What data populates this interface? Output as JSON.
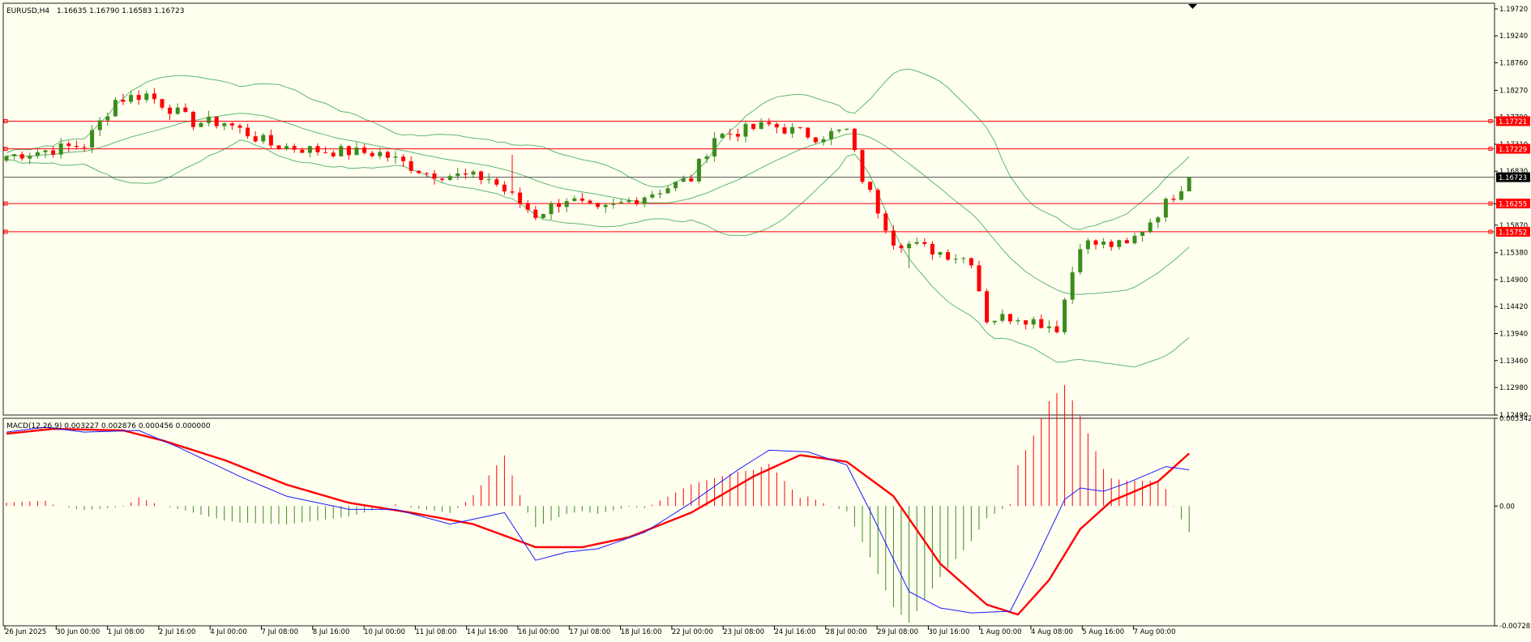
{
  "header": {
    "symbol": "EURUSD,H4",
    "ohlc": "1.16635 1.16790 1.16583 1.16723"
  },
  "colors": {
    "background": "#fffff0",
    "bull": "#3b8c1c",
    "bear": "#ff0000",
    "bands": "#5cb870",
    "hline": "#ff0000",
    "price_line": "#555555",
    "macd_line": "#1a1aff",
    "signal_line": "#ff0000"
  },
  "chart_data": [
    {
      "type": "candlestick",
      "title": "EURUSD,H4",
      "ohlc_readout": "1.16635 1.16790 1.16583 1.16723",
      "ylim": [
        1.1249,
        1.1982
      ],
      "y_ticks": [
        "1.19720",
        "1.19240",
        "1.18760",
        "1.18270",
        "1.17790",
        "1.17310",
        "1.16830",
        "1.16250",
        "1.15870",
        "1.15380",
        "1.14900",
        "1.14420",
        "1.13940",
        "1.13460",
        "1.12980",
        "1.12490"
      ],
      "x_labels": [
        "26 Jun 2025",
        "30 Jun 00:00",
        "1 Jul 08:00",
        "2 Jul 16:00",
        "4 Jul 00:00",
        "7 Jul 08:00",
        "8 Jul 16:00",
        "10 Jul 00:00",
        "11 Jul 08:00",
        "14 Jul 16:00",
        "16 Jul 00:00",
        "17 Jul 08:00",
        "18 Jul 16:00",
        "22 Jul 00:00",
        "23 Jul 08:00",
        "24 Jul 16:00",
        "28 Jul 00:00",
        "29 Jul 08:00",
        "30 Jul 16:00",
        "1 Aug 00:00",
        "4 Aug 08:00",
        "5 Aug 16:00",
        "7 Aug 00:00"
      ],
      "bar_count": 153,
      "anchors": [
        [
          0,
          1.171
        ],
        [
          10,
          1.173
        ],
        [
          14,
          1.181
        ],
        [
          18,
          1.182
        ],
        [
          24,
          1.177
        ],
        [
          28,
          1.177
        ],
        [
          34,
          1.173
        ],
        [
          40,
          1.172
        ],
        [
          48,
          1.1715
        ],
        [
          54,
          1.168
        ],
        [
          62,
          1.167
        ],
        [
          68,
          1.1605
        ],
        [
          72,
          1.1635
        ],
        [
          76,
          1.161
        ],
        [
          80,
          1.163
        ],
        [
          88,
          1.167
        ],
        [
          91,
          1.1745
        ],
        [
          98,
          1.1765
        ],
        [
          104,
          1.1745
        ],
        [
          108,
          1.1755
        ],
        [
          110,
          1.167
        ],
        [
          114,
          1.156
        ],
        [
          124,
          1.1525
        ],
        [
          126,
          1.142
        ],
        [
          130,
          1.1425
        ],
        [
          135,
          1.1405
        ],
        [
          138,
          1.1555
        ],
        [
          144,
          1.155
        ],
        [
          148,
          1.161
        ],
        [
          152,
          1.16723
        ]
      ],
      "horizontal_levels": [
        "1.17721",
        "1.17229",
        "1.16255",
        "1.15752"
      ],
      "current_price": "1.16723",
      "indicator": "Bollinger Bands"
    },
    {
      "type": "line",
      "title": "MACD(12,26,9) 0.003227 0.002876 0.000456 0.000000",
      "ylim": [
        -0.007285,
        0.005342
      ],
      "y_ticks": [
        "0.005342",
        "0.00",
        "-0.007285"
      ],
      "macd_anchors": [
        [
          0,
          0.0045
        ],
        [
          5,
          0.0048
        ],
        [
          10,
          0.0045
        ],
        [
          17,
          0.0046
        ],
        [
          22,
          0.0036
        ],
        [
          30,
          0.0018
        ],
        [
          36,
          0.0006
        ],
        [
          44,
          -0.0002
        ],
        [
          50,
          -0.0002
        ],
        [
          57,
          -0.0011
        ],
        [
          64,
          -0.0004
        ],
        [
          68,
          -0.0033
        ],
        [
          72,
          -0.0028
        ],
        [
          76,
          -0.0026
        ],
        [
          82,
          -0.0016
        ],
        [
          88,
          0.0002
        ],
        [
          94,
          0.0022
        ],
        [
          98,
          0.0034
        ],
        [
          103,
          0.0033
        ],
        [
          108,
          0.0025
        ],
        [
          111,
          -0.0003
        ],
        [
          116,
          -0.0052
        ],
        [
          120,
          -0.0062
        ],
        [
          124,
          -0.0065
        ],
        [
          129,
          -0.0064
        ],
        [
          132,
          -0.0036
        ],
        [
          136,
          0.0004
        ],
        [
          138,
          0.0011
        ],
        [
          141,
          0.0009
        ],
        [
          144,
          0.0014
        ],
        [
          149,
          0.0024
        ],
        [
          152,
          0.0022
        ]
      ],
      "signal_anchors": [
        [
          0,
          0.0044
        ],
        [
          6,
          0.0047
        ],
        [
          15,
          0.0046
        ],
        [
          20,
          0.004
        ],
        [
          28,
          0.0028
        ],
        [
          36,
          0.0013
        ],
        [
          44,
          0.0002
        ],
        [
          52,
          -0.0004
        ],
        [
          60,
          -0.0011
        ],
        [
          68,
          -0.0025
        ],
        [
          74,
          -0.0025
        ],
        [
          80,
          -0.0019
        ],
        [
          88,
          -0.0004
        ],
        [
          96,
          0.0018
        ],
        [
          102,
          0.0031
        ],
        [
          108,
          0.0027
        ],
        [
          114,
          0.0006
        ],
        [
          120,
          -0.0035
        ],
        [
          126,
          -0.006
        ],
        [
          130,
          -0.0066
        ],
        [
          134,
          -0.0045
        ],
        [
          138,
          -0.0014
        ],
        [
          142,
          0.0003
        ],
        [
          148,
          0.0015
        ],
        [
          152,
          0.0032
        ]
      ]
    }
  ],
  "annotations": {
    "hline_labels": [
      "1.17721",
      "1.17229",
      "1.16255",
      "1.15752"
    ],
    "price_label": "1.16723"
  }
}
